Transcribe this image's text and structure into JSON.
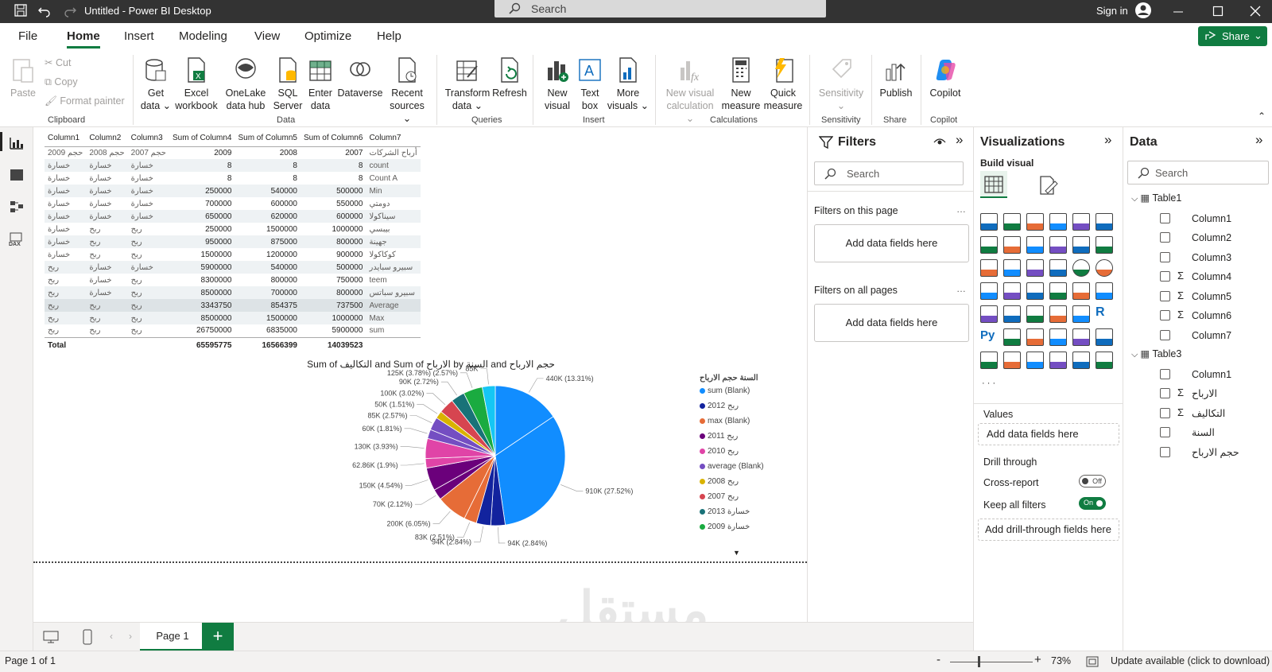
{
  "window": {
    "title": "Untitled - Power BI Desktop",
    "search_placeholder": "Search",
    "sign_in": "Sign in"
  },
  "menu": {
    "items": [
      "File",
      "Home",
      "Insert",
      "Modeling",
      "View",
      "Optimize",
      "Help"
    ],
    "share": "Share"
  },
  "ribbon": {
    "clipboard": {
      "paste": "Paste",
      "cut": "Cut",
      "copy": "Copy",
      "format_painter": "Format painter",
      "group": "Clipboard"
    },
    "data": {
      "get_data": [
        "Get",
        "data"
      ],
      "excel": [
        "Excel",
        "workbook"
      ],
      "onelake": [
        "OneLake",
        "data hub"
      ],
      "sql": [
        "SQL",
        "Server"
      ],
      "enter": [
        "Enter",
        "data"
      ],
      "dataverse": "Dataverse",
      "recent": [
        "Recent",
        "sources"
      ],
      "group": "Data"
    },
    "queries": {
      "transform": [
        "Transform",
        "data"
      ],
      "refresh": "Refresh",
      "group": "Queries"
    },
    "insert": {
      "new_visual": [
        "New",
        "visual"
      ],
      "text_box": [
        "Text",
        "box"
      ],
      "more_visuals": [
        "More",
        "visuals"
      ],
      "group": "Insert"
    },
    "calculations": {
      "new_visual_calc": [
        "New visual",
        "calculation"
      ],
      "new_measure": [
        "New",
        "measure"
      ],
      "quick_measure": [
        "Quick",
        "measure"
      ],
      "group": "Calculations"
    },
    "sensitivity": {
      "label": "Sensitivity",
      "group": "Sensitivity"
    },
    "share": {
      "publish": "Publish",
      "group": "Share"
    },
    "copilot": {
      "label": "Copilot",
      "group": "Copilot"
    }
  },
  "table": {
    "headers": [
      "Column1",
      "Column2",
      "Column3",
      "Sum of Column4",
      "Sum of Column5",
      "Sum of Column6",
      "Column7"
    ],
    "rows": [
      [
        "حجم 2009",
        "حجم 2008",
        "حجم 2007",
        "2009",
        "2008",
        "2007",
        "أرباح الشركات"
      ],
      [
        "خسارة",
        "خسارة",
        "خسارة",
        "8",
        "8",
        "8",
        "count"
      ],
      [
        "خسارة",
        "خسارة",
        "خسارة",
        "8",
        "8",
        "8",
        "Count A"
      ],
      [
        "خسارة",
        "خسارة",
        "خسارة",
        "250000",
        "540000",
        "500000",
        "Min"
      ],
      [
        "خسارة",
        "خسارة",
        "خسارة",
        "700000",
        "600000",
        "550000",
        "دومتي"
      ],
      [
        "خسارة",
        "خسارة",
        "خسارة",
        "650000",
        "620000",
        "600000",
        "سيناكولا"
      ],
      [
        "خسارة",
        "ربح",
        "ربح",
        "250000",
        "1500000",
        "1000000",
        "بيبسي"
      ],
      [
        "خسارة",
        "ربح",
        "ربح",
        "950000",
        "875000",
        "800000",
        "جهينة"
      ],
      [
        "خسارة",
        "ربح",
        "ربح",
        "1500000",
        "1200000",
        "900000",
        "كوكاكولا"
      ],
      [
        "ربح",
        "خسارة",
        "خسارة",
        "5900000",
        "540000",
        "500000",
        "سبيرو سبايدر"
      ],
      [
        "ربح",
        "خسارة",
        "ربح",
        "8300000",
        "800000",
        "750000",
        "teem"
      ],
      [
        "ربح",
        "خسارة",
        "ربح",
        "8500000",
        "700000",
        "800000",
        "سبيرو سباتس"
      ],
      [
        "ربح",
        "ربح",
        "ربح",
        "3343750",
        "854375",
        "737500",
        "Average"
      ],
      [
        "ربح",
        "ربح",
        "ربح",
        "8500000",
        "1500000",
        "1000000",
        "Max"
      ],
      [
        "ربح",
        "ربح",
        "ربح",
        "26750000",
        "6835000",
        "5900000",
        "sum"
      ]
    ],
    "total": [
      "Total",
      "",
      "",
      "65595775",
      "16566399",
      "14039523",
      ""
    ]
  },
  "chart_data": {
    "type": "pie",
    "title": "Sum of التكاليف and Sum of الارباح by السنة and حجم الارباح",
    "legend_title": "السنة حجم الارباح",
    "legend": [
      "sum (Blank)",
      "ربح 2012",
      "max (Blank)",
      "ربح 2011",
      "ربح 2010",
      "average (Blank)",
      "ربح 2008",
      "ربح 2007",
      "خسارة 2013",
      "خسارة 2009"
    ],
    "values": [
      440,
      910,
      94,
      94,
      83,
      200,
      70,
      150,
      62.86,
      130,
      60,
      85,
      50,
      100,
      90,
      125,
      85
    ],
    "labels": [
      "440K (13.31%)",
      "910K (27.52%)",
      "94K (2.84%)",
      "94K (2.84%)",
      "83K (2.51%)",
      "200K (6.05%)",
      "70K (2.12%)",
      "150K (4.54%)",
      "62.86K (1.9%)",
      "130K (3.93%)",
      "60K (1.81%)",
      "85K (2.57%)",
      "50K (1.51%)",
      "100K (3.02%)",
      "90K (2.72%)",
      "125K (3.78%) (2.57%)",
      "85K"
    ],
    "colors": [
      "#118dff",
      "#118dff",
      "#12239e",
      "#12239e",
      "#e66c37",
      "#e66c37",
      "#6b007b",
      "#6b007b",
      "#e044a7",
      "#e044a7",
      "#744ec2",
      "#744ec2",
      "#d9b300",
      "#d64550",
      "#197278",
      "#1aab40",
      "#15c6f4"
    ],
    "legend_colors": [
      "#118dff",
      "#12239e",
      "#e66c37",
      "#6b007b",
      "#e044a7",
      "#744ec2",
      "#d9b300",
      "#d64550",
      "#197278",
      "#1aab40"
    ],
    "legend_placement": "right"
  },
  "filters": {
    "title": "Filters",
    "search": "Search",
    "on_page": "Filters on this page",
    "on_all": "Filters on all pages",
    "add": "Add data fields here"
  },
  "viz": {
    "title": "Visualizations",
    "build": "Build visual",
    "values": "Values",
    "add_fields": "Add data fields here",
    "drill": "Drill through",
    "cross_report": "Cross-report",
    "cross_state": "Off",
    "keep_all": "Keep all filters",
    "keep_state": "On",
    "add_drill": "Add drill-through fields here"
  },
  "data_pane": {
    "title": "Data",
    "search": "Search",
    "tables": [
      {
        "name": "Table1",
        "fields": [
          {
            "name": "Column1",
            "sigma": false
          },
          {
            "name": "Column2",
            "sigma": false
          },
          {
            "name": "Column3",
            "sigma": false
          },
          {
            "name": "Column4",
            "sigma": true
          },
          {
            "name": "Column5",
            "sigma": true
          },
          {
            "name": "Column6",
            "sigma": true
          },
          {
            "name": "Column7",
            "sigma": false
          }
        ]
      },
      {
        "name": "Table3",
        "fields": [
          {
            "name": "Column1",
            "sigma": false
          },
          {
            "name": "الارباح",
            "sigma": true
          },
          {
            "name": "التكاليف",
            "sigma": true
          },
          {
            "name": "السنة",
            "sigma": false
          },
          {
            "name": "حجم الارباح",
            "sigma": false
          }
        ]
      }
    ]
  },
  "pages": {
    "tab": "Page 1"
  },
  "status": {
    "page": "Page 1 of 1",
    "zoom": "73%",
    "update": "Update available (click to download)"
  },
  "colors": {
    "accent": "#107c41",
    "titlebar": "#333333"
  }
}
